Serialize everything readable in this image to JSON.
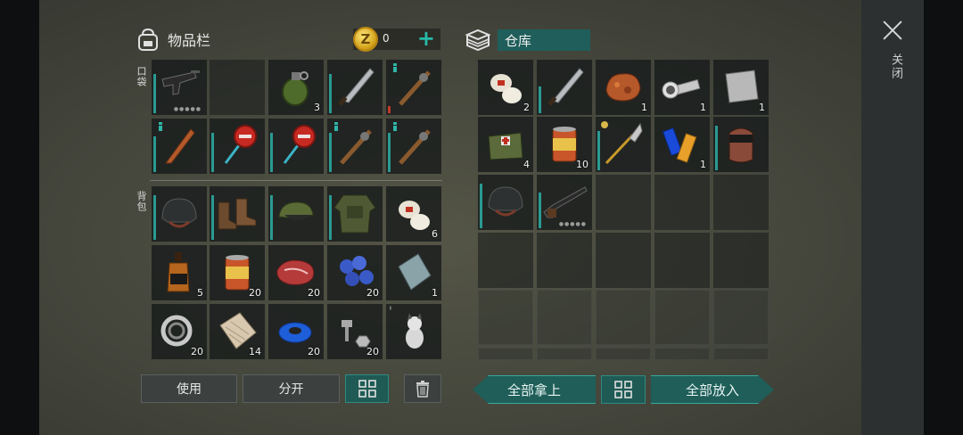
{
  "close": {
    "label": "关闭"
  },
  "inventory": {
    "title": "物品栏",
    "coin_symbol": "Z",
    "coins": "0",
    "plus": "+",
    "pocket_label": "口袋",
    "backpack_label": "背包",
    "slots": [
      {
        "name": "smg-icon",
        "qty": "",
        "dots": "●●●●●"
      },
      {
        "name": "empty",
        "qty": ""
      },
      {
        "name": "grenade-icon",
        "qty": "3"
      },
      {
        "name": "machete-icon",
        "qty": ""
      },
      {
        "name": "spiked-bat-icon",
        "qty": ""
      },
      {
        "name": "dagger-icon",
        "qty": ""
      },
      {
        "name": "stop-sign-icon",
        "qty": ""
      },
      {
        "name": "stop-sign-icon",
        "qty": ""
      },
      {
        "name": "spiked-bat-icon",
        "qty": ""
      },
      {
        "name": "spiked-bat-icon",
        "qty": ""
      },
      {
        "name": "helmet-icon",
        "qty": ""
      },
      {
        "name": "boots-icon",
        "qty": ""
      },
      {
        "name": "cap-icon",
        "qty": ""
      },
      {
        "name": "armor-jacket-icon",
        "qty": ""
      },
      {
        "name": "bandage-icon",
        "qty": "6"
      },
      {
        "name": "whiskey-icon",
        "qty": "5"
      },
      {
        "name": "canned-food-icon",
        "qty": "20"
      },
      {
        "name": "steak-icon",
        "qty": "20"
      },
      {
        "name": "blueberries-icon",
        "qty": "20"
      },
      {
        "name": "metal-plate-icon",
        "qty": "1"
      },
      {
        "name": "bearing-icon",
        "qty": "20"
      },
      {
        "name": "fabric-icon",
        "qty": "14"
      },
      {
        "name": "tape-icon",
        "qty": "20"
      },
      {
        "name": "bolts-icon",
        "qty": "20"
      },
      {
        "name": "dog-figurine-icon",
        "qty": ""
      }
    ],
    "use_button": "使用",
    "split_button": "分开"
  },
  "warehouse": {
    "title": "仓库",
    "slots": [
      {
        "name": "bandage-icon",
        "qty": "2"
      },
      {
        "name": "machete-icon",
        "qty": ""
      },
      {
        "name": "ore-icon",
        "qty": "1"
      },
      {
        "name": "flashlight-icon",
        "qty": "1"
      },
      {
        "name": "metal-sheet-icon",
        "qty": "1"
      },
      {
        "name": "medkit-bag-icon",
        "qty": "4"
      },
      {
        "name": "canned-food-icon",
        "qty": "10"
      },
      {
        "name": "glaive-icon",
        "qty": ""
      },
      {
        "name": "batteries-icon",
        "qty": "1"
      },
      {
        "name": "gas-mask-icon",
        "qty": ""
      },
      {
        "name": "helmet-icon",
        "qty": ""
      },
      {
        "name": "shotgun-icon",
        "qty": "",
        "dots": "●●●●●"
      }
    ],
    "take_all_button": "全部拿上",
    "put_all_button": "全部放入"
  },
  "colors": {
    "accent": "#27b9a8",
    "panel": "#1f5e5a",
    "durability": "#2a9a92",
    "durability_low": "#c23a2a"
  }
}
